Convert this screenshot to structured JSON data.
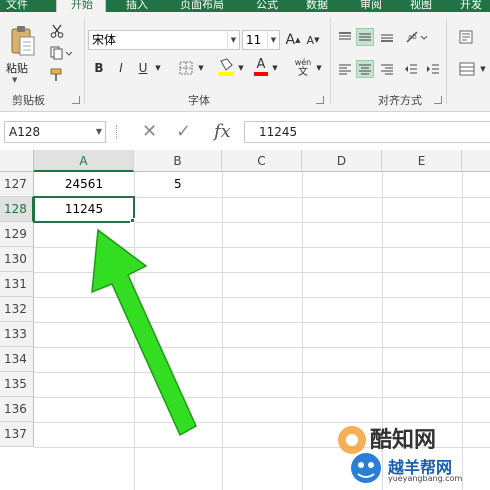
{
  "ribbon_tabs": [
    {
      "label": "文件",
      "active": false
    },
    {
      "label": "开始",
      "active": true
    },
    {
      "label": "插入",
      "active": false
    },
    {
      "label": "页面布局",
      "active": false
    },
    {
      "label": "公式",
      "active": false
    },
    {
      "label": "数据",
      "active": false
    },
    {
      "label": "审阅",
      "active": false
    },
    {
      "label": "视图",
      "active": false
    },
    {
      "label": "开发",
      "active": false
    }
  ],
  "clipboard": {
    "paste_label": "粘贴",
    "group_label": "剪贴板"
  },
  "font": {
    "name": "宋体",
    "size": "11",
    "bold": "B",
    "italic": "I",
    "underline": "U",
    "font_color_glyph": "A",
    "phonetic_top": "wén",
    "phonetic_bottom": "文",
    "group_label": "字体",
    "grow_glyph": "A",
    "shrink_glyph": "A"
  },
  "alignment": {
    "group_label": "对齐方式"
  },
  "name_box": {
    "value": "A128"
  },
  "formula_bar": {
    "value": "11245",
    "cancel_glyph": "✕",
    "enter_glyph": "✓",
    "fx_glyph": "fx"
  },
  "colors": {
    "accent": "#217346",
    "arrow": "#33dd22"
  },
  "sheet": {
    "columns": [
      "A",
      "B",
      "C",
      "D",
      "E"
    ],
    "rows": [
      "127",
      "128",
      "129",
      "130",
      "131",
      "132",
      "133",
      "134",
      "135",
      "136",
      "137"
    ],
    "selected_column": "A",
    "selected_row": "128",
    "cells": {
      "a127": "24561",
      "b127": "5",
      "a128": "11245"
    }
  },
  "watermark": {
    "brand": "酷知网",
    "site": "越羊帮网",
    "url": "yueyangbang.com"
  }
}
